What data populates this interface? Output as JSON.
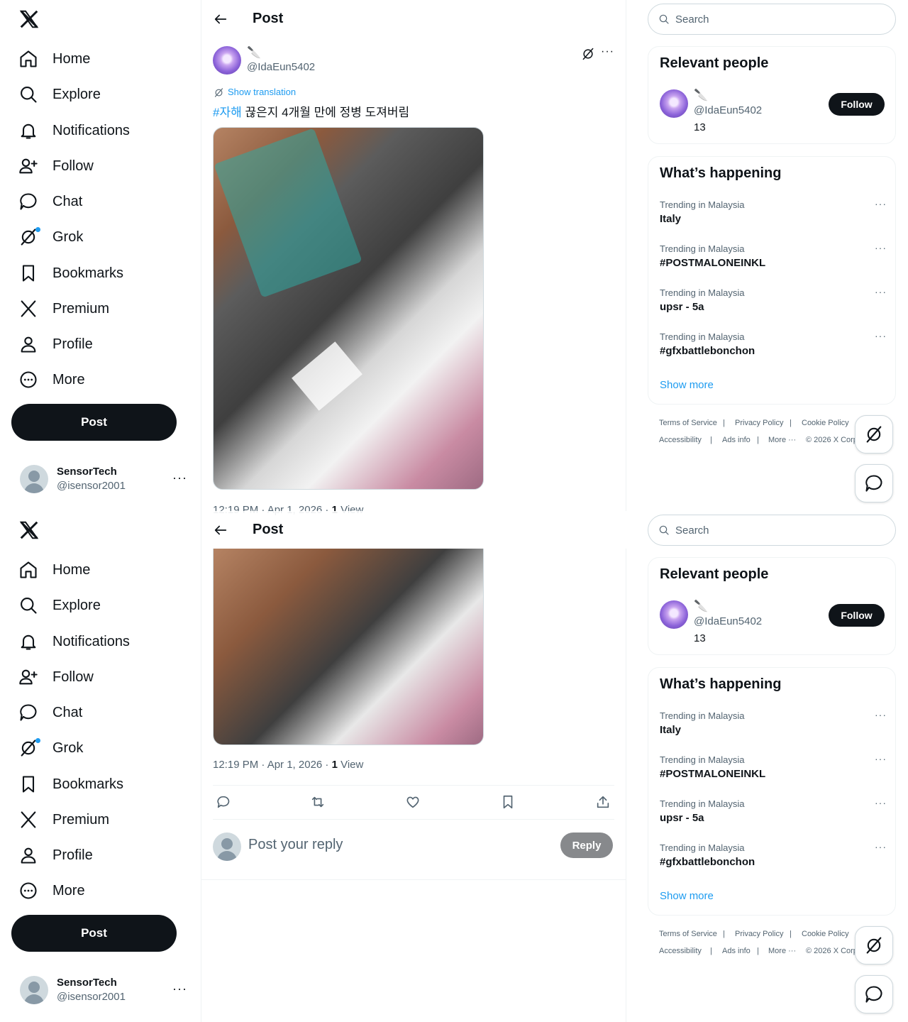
{
  "nav": {
    "items": [
      {
        "label": "Home",
        "icon": "home-icon"
      },
      {
        "label": "Explore",
        "icon": "search-icon"
      },
      {
        "label": "Notifications",
        "icon": "bell-icon"
      },
      {
        "label": "Follow",
        "icon": "person-plus-icon"
      },
      {
        "label": "Chat",
        "icon": "chat-bubble-icon"
      },
      {
        "label": "Grok",
        "icon": "grok-icon"
      },
      {
        "label": "Bookmarks",
        "icon": "bookmark-icon"
      },
      {
        "label": "Premium",
        "icon": "x-logo-icon"
      },
      {
        "label": "Profile",
        "icon": "person-icon"
      },
      {
        "label": "More",
        "icon": "more-circle-icon"
      }
    ],
    "post_label": "Post"
  },
  "account": {
    "name": "SensorTech",
    "handle": "@isensor2001"
  },
  "header": {
    "title": "Post"
  },
  "post": {
    "author_emoji": "🔪",
    "author_handle": "@IdaEun5402",
    "show_translation": "Show translation",
    "hashtag": "#자해",
    "text": " 끊은지 4개월 만에 정병 도져버림",
    "time": "12:19 PM · Apr 1, 2026 · ",
    "views_count": "1",
    "views_label": " View"
  },
  "reply": {
    "placeholder": "Post your reply",
    "button": "Reply"
  },
  "search": {
    "placeholder": "Search"
  },
  "relevant": {
    "title": "Relevant people",
    "person": {
      "emoji": "🔪",
      "handle": "@IdaEun5402",
      "count": "13",
      "follow_label": "Follow"
    }
  },
  "happening": {
    "title": "What’s happening",
    "trends": [
      {
        "context": "Trending in Malaysia",
        "name": "Italy"
      },
      {
        "context": "Trending in Malaysia",
        "name": "#POSTMALONEINKL"
      },
      {
        "context": "Trending in Malaysia",
        "name": "upsr - 5a"
      },
      {
        "context": "Trending in Malaysia",
        "name": "#gfxbattlebonchon"
      }
    ],
    "show_more": "Show more"
  },
  "footer": {
    "links": [
      "Terms of Service",
      "|",
      "Privacy Policy",
      "|",
      "Cookie Policy",
      "Accessibility",
      "|",
      "Ads info",
      "|",
      "More ···",
      "© 2026 X Corp."
    ]
  },
  "colors": {
    "accent": "#1d9bf0",
    "text": "#0f1419",
    "muted": "#536471",
    "button_dark": "#0f1419",
    "reply_disabled": "#87898c"
  }
}
